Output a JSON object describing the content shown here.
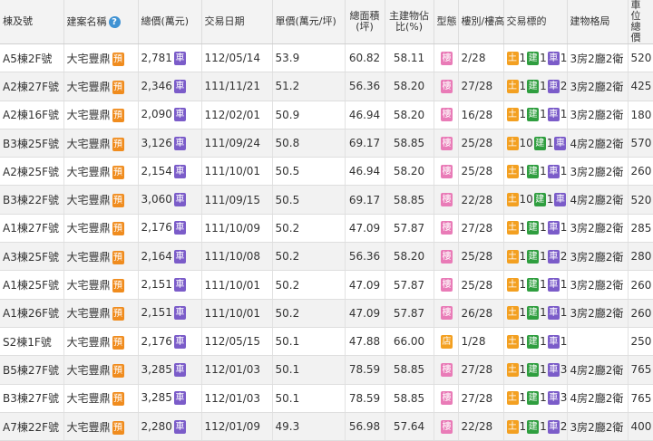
{
  "header": {
    "building_no": "棟及號",
    "project_name": "建案名稱",
    "help_icon": "?",
    "total_price": "總價(萬元)",
    "trade_date": "交易日期",
    "unit_price": "單價(萬元/坪)",
    "total_area": "總面積(坪)",
    "main_ratio": "主建物佔比(%)",
    "type": "型態",
    "floor": "樓別/樓高",
    "trade_target": "交易標的",
    "layout": "建物格局",
    "parking_price": "車位總價"
  },
  "badge_labels": {
    "presale": "預",
    "car": "車",
    "building": "樓",
    "shop": "店",
    "land": "土",
    "build": "建"
  },
  "colors": {
    "presale": "#f08c1e",
    "car": "#7b5cc9",
    "building": "#e97bb7",
    "land": "#f3a021",
    "build": "#2f9e3f"
  },
  "rows": [
    {
      "unit": "A5棟2F號",
      "project": "大宅豐鼎",
      "price": "2,781",
      "date": "112/05/14",
      "unit_price": "53.9",
      "area": "60.82",
      "ratio": "58.11",
      "type": "building",
      "floor": "2/28",
      "land": "1",
      "build": "1",
      "car": "1",
      "layout": "3房2廳2衛",
      "parking": "520"
    },
    {
      "unit": "A2棟27F號",
      "project": "大宅豐鼎",
      "price": "2,346",
      "date": "111/11/21",
      "unit_price": "51.2",
      "area": "56.36",
      "ratio": "58.20",
      "type": "building",
      "floor": "27/28",
      "land": "1",
      "build": "1",
      "car": "2",
      "layout": "3房2廳2衛",
      "parking": "425"
    },
    {
      "unit": "A2棟16F號",
      "project": "大宅豐鼎",
      "price": "2,090",
      "date": "112/02/01",
      "unit_price": "50.9",
      "area": "46.94",
      "ratio": "58.20",
      "type": "building",
      "floor": "16/28",
      "land": "1",
      "build": "1",
      "car": "1",
      "layout": "3房2廳2衛",
      "parking": "180"
    },
    {
      "unit": "B3棟25F號",
      "project": "大宅豐鼎",
      "price": "3,126",
      "date": "111/09/24",
      "unit_price": "50.8",
      "area": "69.17",
      "ratio": "58.85",
      "type": "building",
      "floor": "25/28",
      "land": "10",
      "build": "1",
      "car": "2",
      "layout": "4房2廳2衛",
      "parking": "570"
    },
    {
      "unit": "A2棟25F號",
      "project": "大宅豐鼎",
      "price": "2,154",
      "date": "111/10/01",
      "unit_price": "50.5",
      "area": "46.94",
      "ratio": "58.20",
      "type": "building",
      "floor": "25/28",
      "land": "1",
      "build": "1",
      "car": "1",
      "layout": "3房2廳2衛",
      "parking": "260"
    },
    {
      "unit": "B3棟22F號",
      "project": "大宅豐鼎",
      "price": "3,060",
      "date": "111/09/15",
      "unit_price": "50.5",
      "area": "69.17",
      "ratio": "58.85",
      "type": "building",
      "floor": "22/28",
      "land": "10",
      "build": "1",
      "car": "2",
      "layout": "4房2廳2衛",
      "parking": "520"
    },
    {
      "unit": "A1棟27F號",
      "project": "大宅豐鼎",
      "price": "2,176",
      "date": "111/10/09",
      "unit_price": "50.2",
      "area": "47.09",
      "ratio": "57.87",
      "type": "building",
      "floor": "27/28",
      "land": "1",
      "build": "1",
      "car": "1",
      "layout": "3房2廳2衛",
      "parking": "285"
    },
    {
      "unit": "A3棟25F號",
      "project": "大宅豐鼎",
      "price": "2,164",
      "date": "111/10/08",
      "unit_price": "50.2",
      "area": "56.36",
      "ratio": "58.20",
      "type": "building",
      "floor": "25/28",
      "land": "1",
      "build": "1",
      "car": "2",
      "layout": "3房2廳2衛",
      "parking": "280"
    },
    {
      "unit": "A1棟25F號",
      "project": "大宅豐鼎",
      "price": "2,151",
      "date": "111/10/01",
      "unit_price": "50.2",
      "area": "47.09",
      "ratio": "57.87",
      "type": "building",
      "floor": "25/28",
      "land": "1",
      "build": "1",
      "car": "1",
      "layout": "3房2廳2衛",
      "parking": "260"
    },
    {
      "unit": "A1棟26F號",
      "project": "大宅豐鼎",
      "price": "2,151",
      "date": "111/10/01",
      "unit_price": "50.2",
      "area": "47.09",
      "ratio": "57.87",
      "type": "building",
      "floor": "26/28",
      "land": "1",
      "build": "1",
      "car": "1",
      "layout": "3房2廳2衛",
      "parking": "260"
    },
    {
      "unit": "S2棟1F號",
      "project": "大宅豐鼎",
      "price": "2,176",
      "date": "112/05/15",
      "unit_price": "50.1",
      "area": "47.88",
      "ratio": "66.00",
      "type": "shop",
      "floor": "1/28",
      "land": "1",
      "build": "1",
      "car": "1",
      "layout": "",
      "parking": "250"
    },
    {
      "unit": "B5棟27F號",
      "project": "大宅豐鼎",
      "price": "3,285",
      "date": "112/01/03",
      "unit_price": "50.1",
      "area": "78.59",
      "ratio": "58.85",
      "type": "building",
      "floor": "27/28",
      "land": "1",
      "build": "1",
      "car": "3",
      "layout": "4房2廳2衛",
      "parking": "765"
    },
    {
      "unit": "B3棟27F號",
      "project": "大宅豐鼎",
      "price": "3,285",
      "date": "112/01/03",
      "unit_price": "50.1",
      "area": "78.59",
      "ratio": "58.85",
      "type": "building",
      "floor": "27/28",
      "land": "1",
      "build": "1",
      "car": "3",
      "layout": "4房2廳2衛",
      "parking": "765"
    },
    {
      "unit": "A7棟22F號",
      "project": "大宅豐鼎",
      "price": "2,280",
      "date": "112/01/09",
      "unit_price": "49.3",
      "area": "56.98",
      "ratio": "57.64",
      "type": "building",
      "floor": "22/28",
      "land": "1",
      "build": "1",
      "car": "2",
      "layout": "3房2廳2衛",
      "parking": "400"
    }
  ]
}
